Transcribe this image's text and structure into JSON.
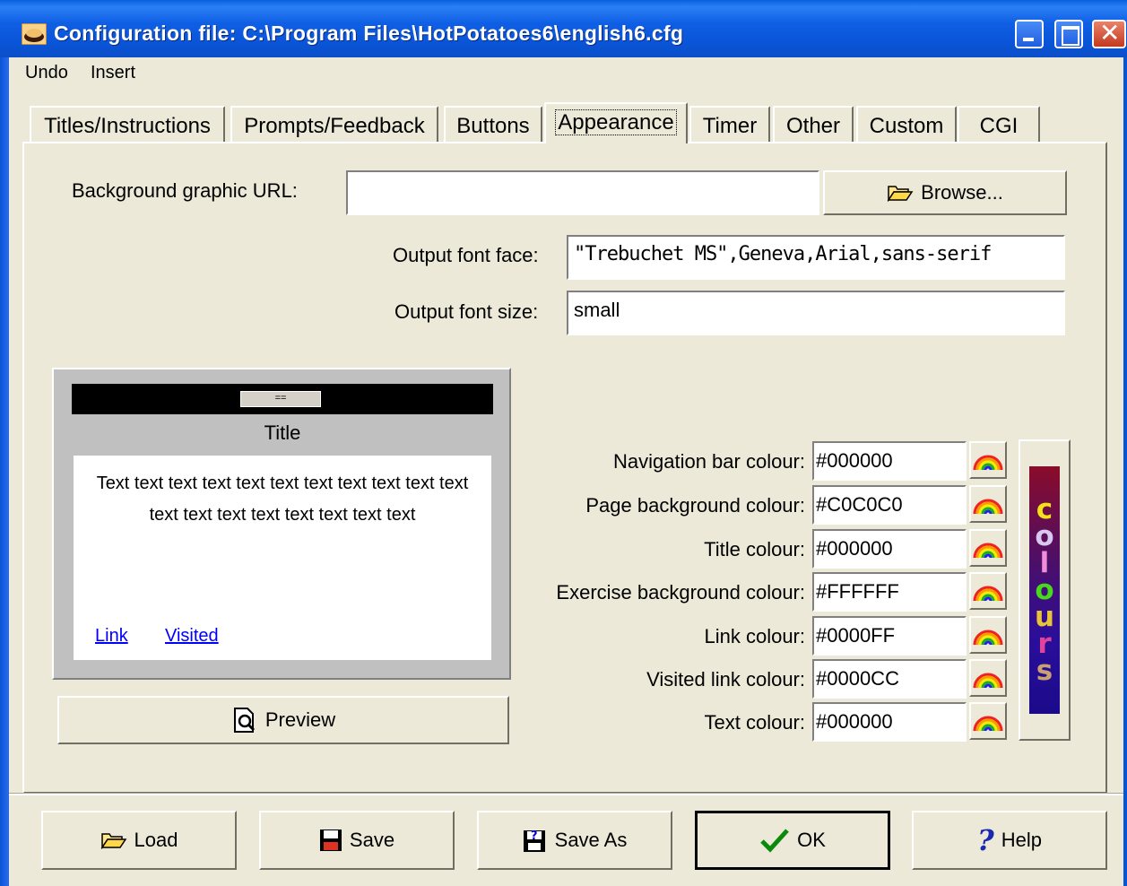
{
  "window": {
    "title": "Configuration file: C:\\Program Files\\HotPotatoes6\\english6.cfg"
  },
  "menu": {
    "items": [
      "Undo",
      "Insert"
    ]
  },
  "tabs": [
    "Titles/Instructions",
    "Prompts/Feedback",
    "Buttons",
    "Appearance",
    "Timer",
    "Other",
    "Custom",
    "CGI"
  ],
  "active_tab": "Appearance",
  "appearance": {
    "bg_graphic_label": "Background graphic URL:",
    "bg_graphic_value": "",
    "browse_label": "Browse...",
    "font_face_label": "Output font face:",
    "font_face_value": "\"Trebuchet MS\",Geneva,Arial,sans-serif",
    "font_size_label": "Output font size:",
    "font_size_value": "small"
  },
  "sample": {
    "nav_button": "==",
    "title": "Title",
    "text": "Text text text text text text text text text text text text text text text text text text text",
    "link": "Link",
    "visited": "Visited"
  },
  "preview_label": "Preview",
  "colours": [
    {
      "label": "Navigation bar colour:",
      "value": "#000000"
    },
    {
      "label": "Page background colour:",
      "value": "#C0C0C0"
    },
    {
      "label": "Title colour:",
      "value": "#000000"
    },
    {
      "label": "Exercise background colour:",
      "value": "#FFFFFF"
    },
    {
      "label": "Link colour:",
      "value": "#0000FF"
    },
    {
      "label": "Visited link colour:",
      "value": "#0000CC"
    },
    {
      "label": "Text colour:",
      "value": "#000000"
    }
  ],
  "colours_button_letters": [
    "c",
    "o",
    "l",
    "o",
    "u",
    "r",
    "s"
  ],
  "buttons": {
    "load": "Load",
    "save": "Save",
    "save_as": "Save As",
    "ok": "OK",
    "help": "Help"
  }
}
